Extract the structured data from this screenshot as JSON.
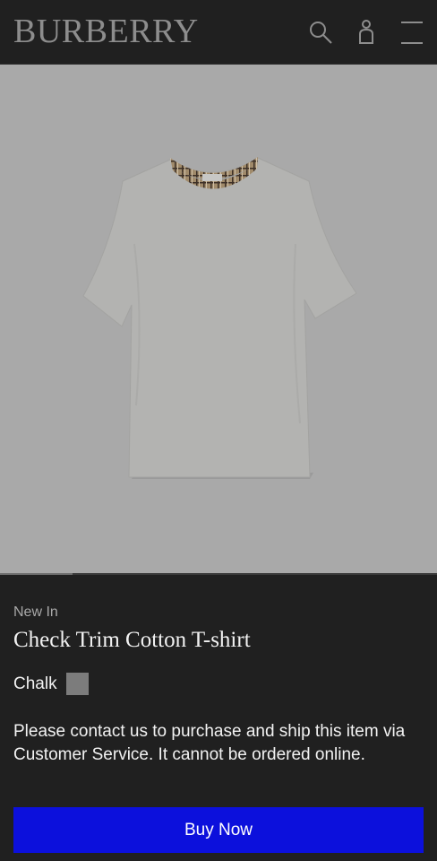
{
  "header": {
    "logo": "BURBERRY",
    "icons": [
      "search-icon",
      "account-icon",
      "menu-icon"
    ]
  },
  "hero": {
    "image": "check-trim-cotton-tshirt-image",
    "gallery_progress": 0.165
  },
  "product": {
    "badge": "New In",
    "title": "Check Trim Cotton T-shirt",
    "color_label": "Chalk",
    "swatch_color": "#7c7c7c",
    "notice": "Please contact us to purchase and ship this item via Customer Service. It cannot be ordered online.",
    "buy_label": "Buy Now"
  },
  "colors": {
    "header_bg": "#202020",
    "buy_button": "#0c10dc",
    "image_bg": "#a9a9a9"
  }
}
